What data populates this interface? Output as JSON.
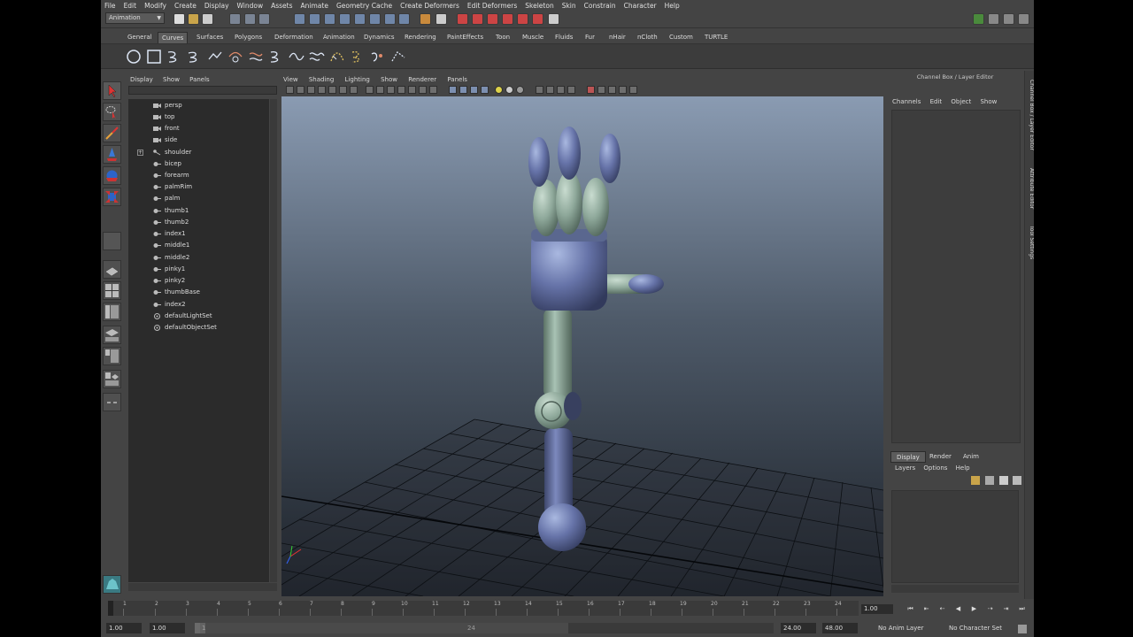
{
  "menubar": [
    "File",
    "Edit",
    "Modify",
    "Create",
    "Display",
    "Window",
    "Assets",
    "Animate",
    "Geometry Cache",
    "Create Deformers",
    "Edit Deformers",
    "Skeleton",
    "Skin",
    "Constrain",
    "Character",
    "Help"
  ],
  "status": {
    "mode": "Animation"
  },
  "shelf_tabs": [
    "General",
    "Curves",
    "Surfaces",
    "Polygons",
    "Deformation",
    "Animation",
    "Dynamics",
    "Rendering",
    "PaintEffects",
    "Toon",
    "Muscle",
    "Fluids",
    "Fur",
    "nHair",
    "nCloth",
    "Custom",
    "TURTLE"
  ],
  "active_shelf": "Curves",
  "outliner": {
    "menu": [
      "Display",
      "Show",
      "Panels"
    ],
    "items": [
      "persp",
      "top",
      "front",
      "side",
      "shoulder",
      "bicep",
      "forearm",
      "palmRim",
      "palm",
      "thumb1",
      "thumb2",
      "index1",
      "middle1",
      "middle2",
      "pinky1",
      "pinky2",
      "thumbBase",
      "index2",
      "defaultLightSet",
      "defaultObjectSet"
    ]
  },
  "viewport": {
    "menu": [
      "View",
      "Shading",
      "Lighting",
      "Show",
      "Renderer",
      "Panels"
    ],
    "background_top": "#8a9bb2",
    "background_bottom": "#1c2128"
  },
  "channel_box": {
    "title": "Channel Box / Layer Editor",
    "menu": [
      "Channels",
      "Edit",
      "Object",
      "Show"
    ],
    "layer_tabs": [
      "Display",
      "Render",
      "Anim"
    ],
    "active_layer_tab": "Display",
    "layer_menu": [
      "Layers",
      "Options",
      "Help"
    ]
  },
  "side_tabs": [
    "Channel Box / Layer Editor",
    "Attribute Editor",
    "Tool Settings"
  ],
  "timeline": {
    "ticks": [
      "1",
      "2",
      "3",
      "4",
      "5",
      "6",
      "7",
      "8",
      "9",
      "10",
      "11",
      "12",
      "13",
      "14",
      "15",
      "16",
      "17",
      "18",
      "19",
      "20",
      "21",
      "22",
      "23",
      "24"
    ],
    "current_frame": "1.00"
  },
  "range": {
    "start": "1.00",
    "playback_start": "1.00",
    "slider_start": "1",
    "slider_end": "24",
    "playback_end": "24.00",
    "end": "48.00",
    "anim_layer": "No Anim Layer",
    "character_set": "No Character Set"
  },
  "colors": {
    "ui_bg": "#444444",
    "accent_tab": "#5c5c5c"
  }
}
